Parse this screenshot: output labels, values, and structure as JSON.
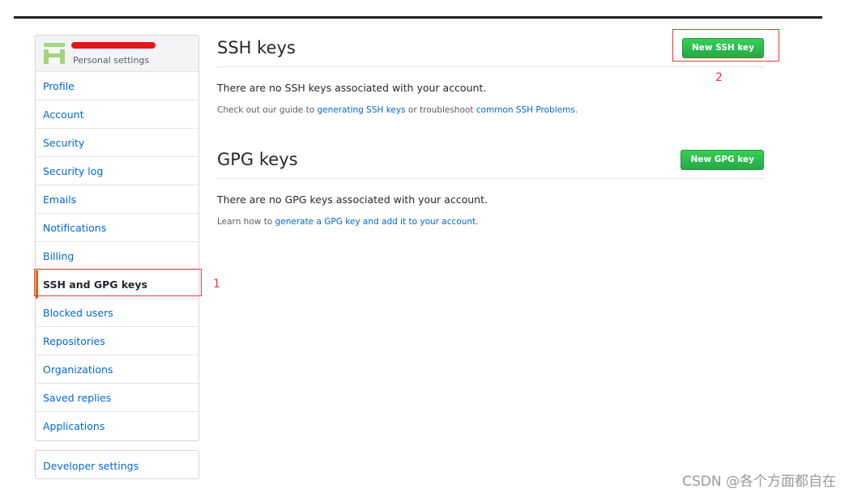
{
  "sidebar": {
    "subtitle": "Personal settings",
    "items": [
      {
        "label": "Profile"
      },
      {
        "label": "Account"
      },
      {
        "label": "Security"
      },
      {
        "label": "Security log"
      },
      {
        "label": "Emails"
      },
      {
        "label": "Notifications"
      },
      {
        "label": "Billing"
      },
      {
        "label": "SSH and GPG keys",
        "selected": true
      },
      {
        "label": "Blocked users"
      },
      {
        "label": "Repositories"
      },
      {
        "label": "Organizations"
      },
      {
        "label": "Saved replies"
      },
      {
        "label": "Applications"
      }
    ],
    "developer": "Developer settings"
  },
  "ssh": {
    "title": "SSH keys",
    "button": "New SSH key",
    "message": "There are no SSH keys associated with your account.",
    "note_pre": "Check out our guide to ",
    "link1": "generating SSH keys",
    "note_mid": " or troubleshoot ",
    "link2": "common SSH Problems",
    "note_end": "."
  },
  "gpg": {
    "title": "GPG keys",
    "button": "New GPG key",
    "message": "There are no GPG keys associated with your account.",
    "note_pre": "Learn how to ",
    "link1": "generate a GPG key and add it to your account",
    "note_end": "."
  },
  "annotations": {
    "one": "1",
    "two": "2",
    "color": "#ff3333"
  },
  "watermark": "CSDN @各个方面都自在"
}
